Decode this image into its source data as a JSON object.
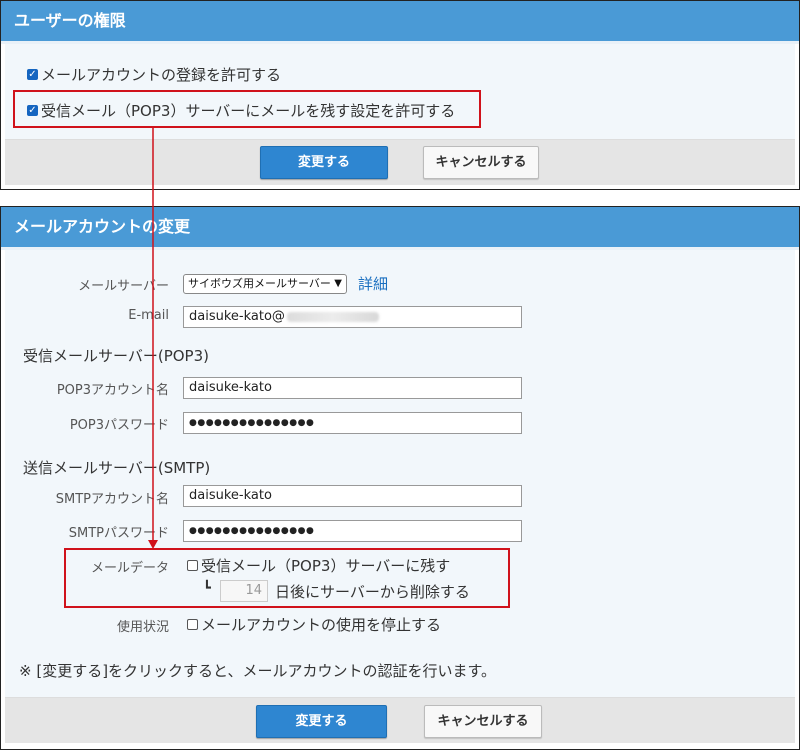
{
  "permissions_panel": {
    "title": "ユーザーの権限",
    "allow_mail_account_registration": {
      "label": "メールアカウントの登録を許可する",
      "checked": true
    },
    "allow_keep_mail_on_server": {
      "label": "受信メール（POP3）サーバーにメールを残す設定を許可する",
      "checked": true
    },
    "save_label": "変更する",
    "cancel_label": "キャンセルする"
  },
  "account_panel": {
    "title": "メールアカウントの変更",
    "mail_server": {
      "label": "メールサーバー",
      "selected": "サイボウズ用メールサーバー",
      "details_link": "詳細"
    },
    "email": {
      "label": "E-mail",
      "value": "daisuke-kato@"
    },
    "pop3_section": "受信メールサーバー(POP3)",
    "pop3_account": {
      "label": "POP3アカウント名",
      "value": "daisuke-kato"
    },
    "pop3_password": {
      "label": "POP3パスワード",
      "value": "●●●●●●●●●●●●●●●"
    },
    "smtp_section": "送信メールサーバー(SMTP)",
    "smtp_account": {
      "label": "SMTPアカウント名",
      "value": "daisuke-kato"
    },
    "smtp_password": {
      "label": "SMTPパスワード",
      "value": "●●●●●●●●●●●●●●●"
    },
    "mail_data": {
      "label": "メールデータ",
      "keep_on_server": {
        "label": "受信メール（POP3）サーバーに残す",
        "checked": false
      },
      "corner": "┗",
      "days_value": "14",
      "days_suffix": "日後にサーバーから削除する"
    },
    "usage": {
      "label": "使用状況",
      "suspend": {
        "label": "メールアカウントの使用を停止する",
        "checked": false
      }
    },
    "note": "※ [変更する]をクリックすると、メールアカウントの認証を行います。",
    "save_label": "変更する",
    "cancel_label": "キャンセルする"
  },
  "colors": {
    "header": "#4a9ad6",
    "primary_button": "#2e86d1",
    "annotation": "#d0121b",
    "link": "#1a6fc0"
  }
}
